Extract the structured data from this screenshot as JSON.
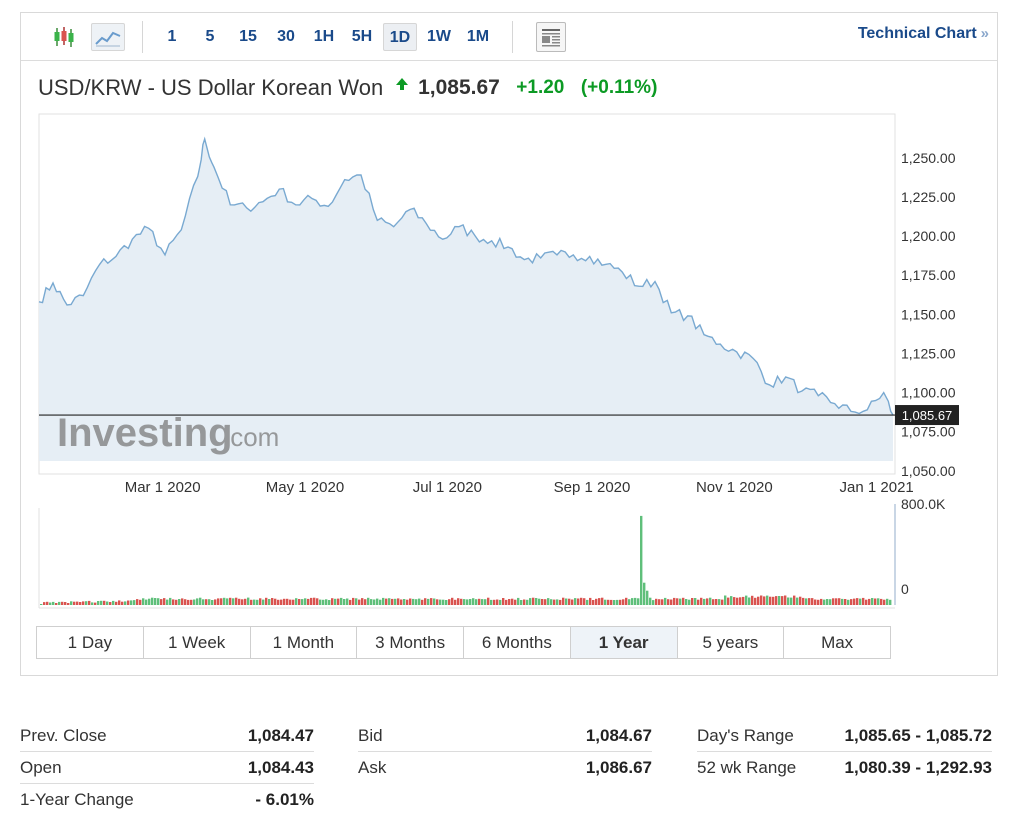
{
  "toolbar": {
    "intervals": [
      "1",
      "5",
      "15",
      "30",
      "1H",
      "5H",
      "1D",
      "1W",
      "1M"
    ],
    "active_interval": "1D",
    "technical_chart_label": "Technical Chart",
    "chevron": "»",
    "icons": [
      "candlestick-icon",
      "area-chart-icon",
      "document-icon"
    ]
  },
  "instrument": {
    "name": "USD/KRW - US Dollar Korean Won",
    "price": "1,085.67",
    "change": "+1.20",
    "change_pct": "(+0.11%)",
    "direction": "up",
    "up_color": "#0c9a24"
  },
  "watermark": {
    "brand": "Investing",
    "suffix": ".com"
  },
  "chart_data": {
    "type": "area",
    "x_tick_labels": [
      "Mar 1 2020",
      "May 1 2020",
      "Jul 1 2020",
      "Sep 1 2020",
      "Nov 1 2020",
      "Jan 1 2021"
    ],
    "x_tick_dates": [
      "2020-03-01",
      "2020-05-01",
      "2020-07-01",
      "2020-09-01",
      "2020-11-01",
      "2021-01-01"
    ],
    "y_tick_labels": [
      "1,250.00",
      "1,225.00",
      "1,200.00",
      "1,175.00",
      "1,150.00",
      "1,125.00",
      "1,100.00",
      "1,075.00",
      "1,050.00"
    ],
    "y_ticks": [
      1250,
      1225,
      1200,
      1175,
      1150,
      1125,
      1100,
      1075,
      1050
    ],
    "ylim": [
      1048,
      1278
    ],
    "xlim": [
      "2020-01-08",
      "2021-01-08"
    ],
    "last_price_label": "1,085.67",
    "last_price": 1085.67,
    "line_color": "#79a9d1",
    "fill_color": "#e6eef5",
    "dates": [
      "2020-01-08",
      "2020-01-14",
      "2020-01-20",
      "2020-01-27",
      "2020-02-03",
      "2020-02-10",
      "2020-02-17",
      "2020-02-24",
      "2020-03-02",
      "2020-03-09",
      "2020-03-16",
      "2020-03-19",
      "2020-03-23",
      "2020-03-30",
      "2020-04-06",
      "2020-04-13",
      "2020-04-20",
      "2020-04-27",
      "2020-05-04",
      "2020-05-11",
      "2020-05-18",
      "2020-05-25",
      "2020-06-01",
      "2020-06-08",
      "2020-06-15",
      "2020-06-22",
      "2020-06-29",
      "2020-07-06",
      "2020-07-13",
      "2020-07-20",
      "2020-07-27",
      "2020-08-03",
      "2020-08-10",
      "2020-08-17",
      "2020-08-24",
      "2020-08-31",
      "2020-09-07",
      "2020-09-14",
      "2020-09-21",
      "2020-09-28",
      "2020-10-05",
      "2020-10-12",
      "2020-10-19",
      "2020-10-26",
      "2020-11-02",
      "2020-11-09",
      "2020-11-16",
      "2020-11-23",
      "2020-11-30",
      "2020-12-07",
      "2020-12-14",
      "2020-12-21",
      "2020-12-28",
      "2021-01-04",
      "2021-01-08"
    ],
    "values": [
      1158,
      1170,
      1156,
      1162,
      1182,
      1187,
      1198,
      1205,
      1188,
      1204,
      1238,
      1262,
      1244,
      1220,
      1218,
      1222,
      1230,
      1220,
      1224,
      1219,
      1236,
      1239,
      1210,
      1206,
      1217,
      1208,
      1198,
      1206,
      1200,
      1197,
      1193,
      1185,
      1186,
      1188,
      1188,
      1187,
      1182,
      1177,
      1168,
      1171,
      1151,
      1149,
      1137,
      1131,
      1126,
      1122,
      1105,
      1110,
      1101,
      1098,
      1093,
      1088,
      1089,
      1100,
      1085.67
    ],
    "volume": {
      "ymax_label": "800.0K",
      "ymin_label": "0",
      "ymax": 800000,
      "typical": 55000,
      "spike_date": "2020-09-22",
      "spike_value": 720000,
      "up_color": "#5fbf7a",
      "down_color": "#d9534f"
    }
  },
  "ranges": {
    "items": [
      "1 Day",
      "1 Week",
      "1 Month",
      "3 Months",
      "6 Months",
      "1 Year",
      "5 years",
      "Max"
    ],
    "active": "1 Year"
  },
  "stats": {
    "col1": [
      {
        "label": "Prev. Close",
        "value": "1,084.47"
      },
      {
        "label": "Open",
        "value": "1,084.43"
      },
      {
        "label": "1-Year Change",
        "value": "- 6.01%"
      }
    ],
    "col2": [
      {
        "label": "Bid",
        "value": "1,084.67"
      },
      {
        "label": "Ask",
        "value": "1,086.67"
      }
    ],
    "col3": [
      {
        "label": "Day's Range",
        "value": "1,085.65 - 1,085.72"
      },
      {
        "label": "52 wk Range",
        "value": "1,080.39 - 1,292.93"
      }
    ]
  }
}
